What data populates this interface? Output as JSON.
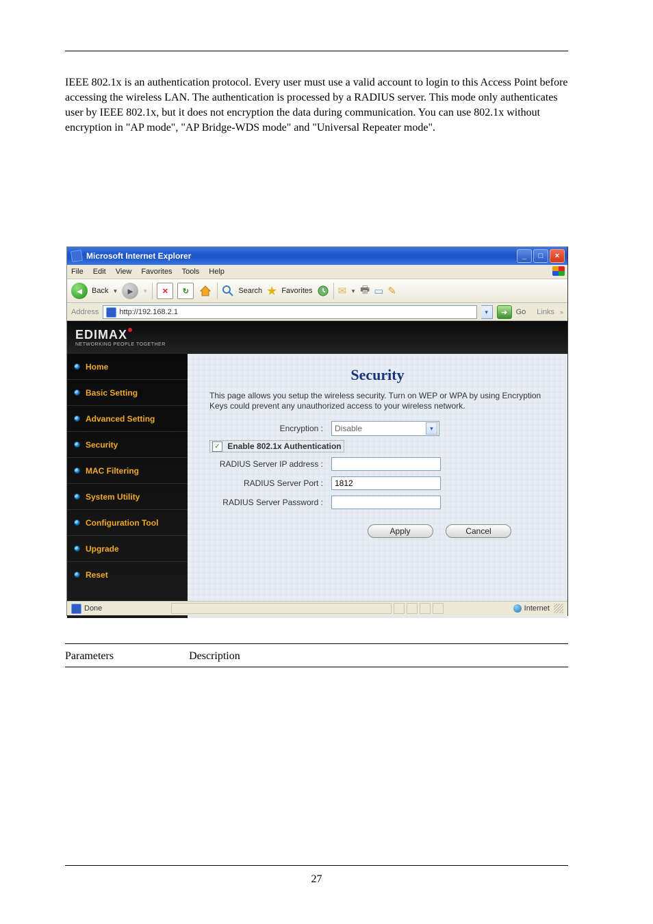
{
  "page": {
    "number_label": "27"
  },
  "window": {
    "title": "Microsoft Internet Explorer"
  },
  "menu": [
    "File",
    "Edit",
    "View",
    "Favorites",
    "Tools",
    "Help"
  ],
  "toolbar": {
    "back": "Back",
    "search": "Search",
    "favorites": "Favorites"
  },
  "addressbar": {
    "label": "Address",
    "url": "http://192.168.2.1",
    "go": "Go",
    "links": "Links"
  },
  "brand": {
    "name": "EDIMAX",
    "tagline": "NETWORKING PEOPLE TOGETHER"
  },
  "nav": [
    "Home",
    "Basic Setting",
    "Advanced Setting",
    "Security",
    "MAC Filtering",
    "System Utility",
    "Configuration Tool",
    "Upgrade",
    "Reset"
  ],
  "security": {
    "title": "Security",
    "desc": "This page allows you setup the wireless security. Turn on WEP or WPA by using Encryption Keys could prevent any unauthorized access to your wireless network.",
    "encryption_label": "Encryption :",
    "encryption_value": "Disable",
    "enable_8021x_label": "Enable 802.1x Authentication",
    "radius_ip_label": "RADIUS Server IP address :",
    "radius_ip_value": "",
    "radius_port_label": "RADIUS Server Port :",
    "radius_port_value": "1812",
    "radius_pw_label": "RADIUS Server Password :",
    "radius_pw_value": "",
    "apply": "Apply",
    "cancel": "Cancel"
  },
  "statusbar": {
    "done": "Done",
    "zone": "Internet"
  },
  "doc": {
    "row_param": "Parameters",
    "row_desc": "Description",
    "p1": "IEEE 802.1x is an authentication protocol. Every user must use a valid account to login to this Access Point before accessing the wireless LAN. The authentication is processed by a RADIUS server. This mode only authenticates user by IEEE 802.1x, but it does not encryption the data during communication. You can use 802.1x without encryption in \"AP mode\", \"AP Bridge-WDS mode\" and \"Universal Repeater mode\"."
  }
}
